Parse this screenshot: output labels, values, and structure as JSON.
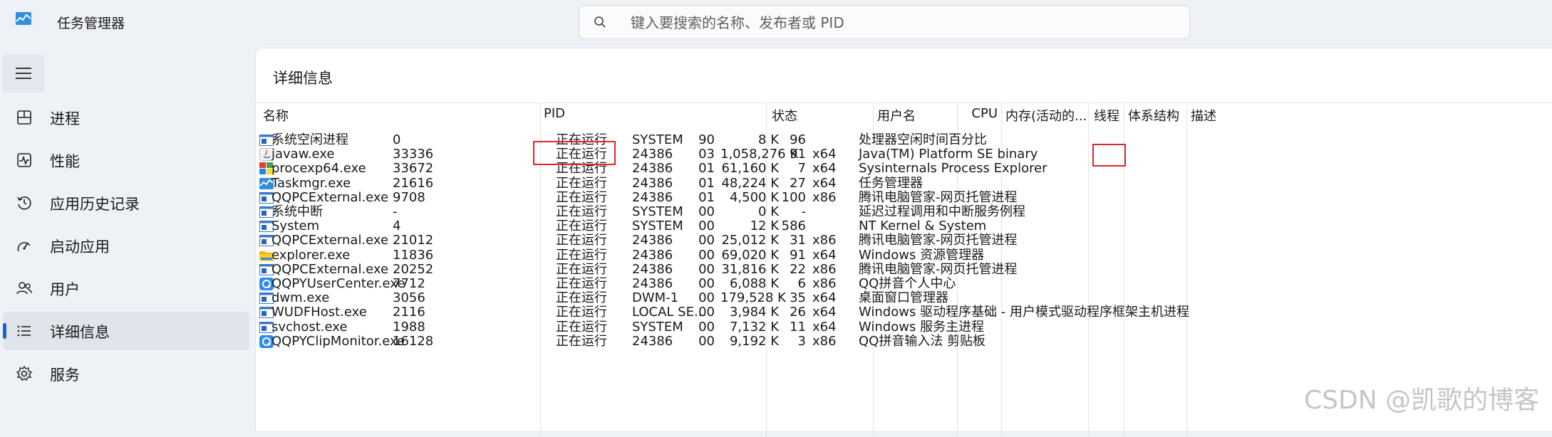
{
  "app": {
    "title": "任务管理器"
  },
  "search": {
    "placeholder": "键入要搜索的名称、发布者或 PID"
  },
  "sidebar": {
    "items": [
      {
        "label": "进程",
        "icon": "processes-icon"
      },
      {
        "label": "性能",
        "icon": "performance-icon"
      },
      {
        "label": "应用历史记录",
        "icon": "app-history-icon"
      },
      {
        "label": "启动应用",
        "icon": "startup-apps-icon"
      },
      {
        "label": "用户",
        "icon": "users-icon"
      },
      {
        "label": "详细信息",
        "icon": "details-icon",
        "active": true
      },
      {
        "label": "服务",
        "icon": "services-icon"
      }
    ]
  },
  "main": {
    "title": "详细信息",
    "columns": [
      "名称",
      "PID",
      "状态",
      "用户名",
      "CPU",
      "内存(活动的...",
      "线程",
      "体系结构",
      "描述"
    ],
    "rows": [
      {
        "icon": "window-icon",
        "name": "系统空闲进程",
        "pid": "0",
        "status": "正在运行",
        "user": "SYSTEM",
        "cpu": "90",
        "mem": "8 K",
        "threads": "96",
        "arch": "",
        "desc": "处理器空闲时间百分比"
      },
      {
        "icon": "java-icon",
        "name": "javaw.exe",
        "pid": "33336",
        "status": "正在运行",
        "user": "24386",
        "cpu": "03",
        "mem": "1,058,276 K",
        "threads": "91",
        "arch": "x64",
        "desc": "Java(TM) Platform SE binary"
      },
      {
        "icon": "procexp-icon",
        "name": "procexp64.exe",
        "pid": "33672",
        "status": "正在运行",
        "user": "24386",
        "cpu": "01",
        "mem": "61,160 K",
        "threads": "7",
        "arch": "x64",
        "desc": "Sysinternals Process Explorer"
      },
      {
        "icon": "taskmgr-icon",
        "name": "Taskmgr.exe",
        "pid": "21616",
        "status": "正在运行",
        "user": "24386",
        "cpu": "01",
        "mem": "48,224 K",
        "threads": "27",
        "arch": "x64",
        "desc": "任务管理器"
      },
      {
        "icon": "window-icon",
        "name": "QQPCExternal.exe",
        "pid": "9708",
        "status": "正在运行",
        "user": "24386",
        "cpu": "01",
        "mem": "4,500 K",
        "threads": "100",
        "arch": "x86",
        "desc": "腾讯电脑管家-网页托管进程"
      },
      {
        "icon": "window-icon",
        "name": "系统中断",
        "pid": "-",
        "status": "正在运行",
        "user": "SYSTEM",
        "cpu": "00",
        "mem": "0 K",
        "threads": "-",
        "arch": "",
        "desc": "延迟过程调用和中断服务例程"
      },
      {
        "icon": "window-icon",
        "name": "System",
        "pid": "4",
        "status": "正在运行",
        "user": "SYSTEM",
        "cpu": "00",
        "mem": "12 K",
        "threads": "586",
        "arch": "",
        "desc": "NT Kernel & System"
      },
      {
        "icon": "window-icon",
        "name": "QQPCExternal.exe",
        "pid": "21012",
        "status": "正在运行",
        "user": "24386",
        "cpu": "00",
        "mem": "25,012 K",
        "threads": "31",
        "arch": "x86",
        "desc": "腾讯电脑管家-网页托管进程"
      },
      {
        "icon": "folder-icon",
        "name": "explorer.exe",
        "pid": "11836",
        "status": "正在运行",
        "user": "24386",
        "cpu": "00",
        "mem": "69,020 K",
        "threads": "91",
        "arch": "x64",
        "desc": "Windows 资源管理器"
      },
      {
        "icon": "window-icon",
        "name": "QQPCExternal.exe",
        "pid": "20252",
        "status": "正在运行",
        "user": "24386",
        "cpu": "00",
        "mem": "31,816 K",
        "threads": "22",
        "arch": "x86",
        "desc": "腾讯电脑管家-网页托管进程"
      },
      {
        "icon": "qq-pinyin-icon",
        "name": "QQPYUserCenter.exe",
        "pid": "7712",
        "status": "正在运行",
        "user": "24386",
        "cpu": "00",
        "mem": "6,088 K",
        "threads": "6",
        "arch": "x86",
        "desc": "QQ拼音个人中心"
      },
      {
        "icon": "window-icon",
        "name": "dwm.exe",
        "pid": "3056",
        "status": "正在运行",
        "user": "DWM-1",
        "cpu": "00",
        "mem": "179,528 K",
        "threads": "35",
        "arch": "x64",
        "desc": "桌面窗口管理器"
      },
      {
        "icon": "window-icon",
        "name": "WUDFHost.exe",
        "pid": "2116",
        "status": "正在运行",
        "user": "LOCAL SE...",
        "cpu": "00",
        "mem": "3,984 K",
        "threads": "26",
        "arch": "x64",
        "desc": "Windows 驱动程序基础 - 用户模式驱动程序框架主机进程"
      },
      {
        "icon": "window-icon",
        "name": "svchost.exe",
        "pid": "1988",
        "status": "正在运行",
        "user": "SYSTEM",
        "cpu": "00",
        "mem": "7,132 K",
        "threads": "11",
        "arch": "x64",
        "desc": "Windows 服务主进程"
      },
      {
        "icon": "qq-pinyin-icon",
        "name": "QQPYClipMonitor.exe",
        "pid": "16128",
        "status": "正在运行",
        "user": "24386",
        "cpu": "00",
        "mem": "9,192 K",
        "threads": "3",
        "arch": "x86",
        "desc": "QQ拼音输入法 剪贴板"
      }
    ]
  },
  "watermark": "CSDN @凯歌的博客",
  "colors": {
    "accent": "#1469c7",
    "highlight": "#e0242b",
    "panel": "#ffffff",
    "background": "#eef1f6"
  }
}
